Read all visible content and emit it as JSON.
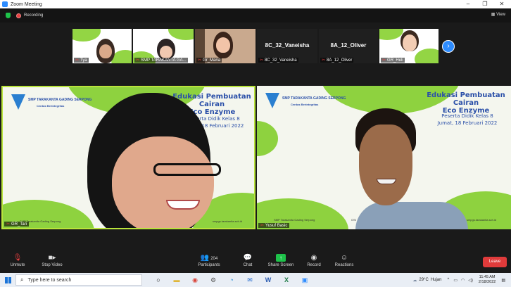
{
  "window": {
    "title": "Zoom Meeting"
  },
  "top_bar": {
    "recording_label": "Recording",
    "view_label": "View"
  },
  "thumbnails": [
    {
      "name": "Tya",
      "kind": "video"
    },
    {
      "name": "SMP TARAKANTA GA...",
      "kind": "video"
    },
    {
      "name": "Gr_Maria",
      "kind": "video"
    },
    {
      "name": "8C_32_Vaneisha",
      "kind": "name",
      "big_label": "8C_32_Vaneisha"
    },
    {
      "name": "8A_12_Oliver",
      "kind": "name",
      "big_label": "8A_12_Oliver"
    },
    {
      "name": "GR_Heli",
      "kind": "video"
    }
  ],
  "main_tiles": [
    {
      "name": "GR_Tari",
      "school": "SMP TARAKANTA GADING SERPONG",
      "motto": "Cerdas Berintegritas",
      "title_lines": [
        "Edukasi Pembuatan Cairan",
        "Eco Enzyme"
      ],
      "sub_lines": [
        "Peserta Didik Kelas 8",
        "Jumat, 18 Februari 2022"
      ],
      "footer_left": "SMP Tarakanita Gading Serpong",
      "footer_right": "smpgs.tarakanita.sch.id"
    },
    {
      "name": "Yusuf Basic",
      "school": "SMP TARAKANTA GADING SERPONG",
      "motto": "Cerdas Berintegritas",
      "title_lines": [
        "Edukasi Pembuatan Cairan",
        "Eco Enzyme"
      ],
      "sub_lines": [
        "Peserta Didik Kelas 8",
        "Jumat, 18 Februari 2022"
      ],
      "footer_left": "SMP Tarakanita Gading Serpong",
      "footer_right": "smpgs.tarakanita.sch.id",
      "footer_extra": "OSI"
    }
  ],
  "toolbar": {
    "unmute": "Unmute",
    "stop_video": "Stop Video",
    "participants": "Participants",
    "participants_count": "204",
    "chat": "Chat",
    "share_screen": "Share Screen",
    "record": "Record",
    "reactions": "Reactions",
    "leave": "Leave"
  },
  "taskbar": {
    "search_placeholder": "Type here to search",
    "temperature": "29°C",
    "weather": "Hujan",
    "time": "11:45 AM",
    "date": "2/18/2022"
  },
  "colors": {
    "accent": "#2d8cff",
    "leave": "#e03b3b",
    "share": "#1ec24a",
    "slide_green": "#8ed23f"
  }
}
